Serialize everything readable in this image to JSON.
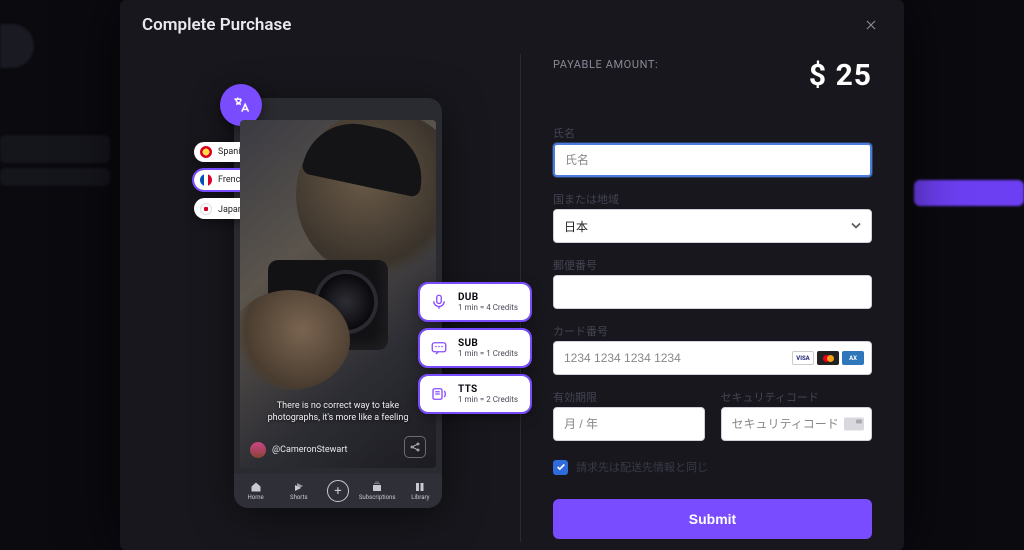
{
  "modal": {
    "title": "Complete Purchase",
    "close_icon": "close"
  },
  "payment": {
    "amount_label": "PAYABLE AMOUNT:",
    "amount_value": "$ 25"
  },
  "illustration": {
    "translate_icon": "translate",
    "languages": [
      {
        "label": "Spanish (Español)",
        "flag": "es",
        "selected": false
      },
      {
        "label": "French (français)",
        "flag": "fr",
        "selected": true
      },
      {
        "label": "Japanese (日本)",
        "flag": "jp",
        "selected": false
      }
    ],
    "caption": "There is no correct way to take photographs, it's more like a feeling",
    "username": "@CameronStewart",
    "nav": {
      "home": "Home",
      "shorts": "Shorts",
      "subscriptions": "Subscriptions",
      "library": "Library"
    },
    "credits": [
      {
        "title": "DUB",
        "sub": "1 min = 4 Credits",
        "icon": "mic"
      },
      {
        "title": "SUB",
        "sub": "1 min = 1 Credits",
        "icon": "chat"
      },
      {
        "title": "TTS",
        "sub": "1 min = 2 Credits",
        "icon": "speaker"
      }
    ]
  },
  "form": {
    "name": {
      "label": "氏名",
      "placeholder": "氏名",
      "value": ""
    },
    "country": {
      "label": "国または地域",
      "value": "日本"
    },
    "postal": {
      "label": "郵便番号",
      "placeholder": "",
      "value": ""
    },
    "card": {
      "label": "カード番号",
      "placeholder": "1234 1234 1234 1234",
      "value": ""
    },
    "expiry": {
      "label": "有効期限",
      "placeholder": "月 / 年",
      "value": ""
    },
    "cvc": {
      "label": "セキュリティコード",
      "placeholder": "セキュリティコード",
      "value": ""
    },
    "same_as_shipping": {
      "checked": true,
      "label": "請求先は配送先情報と同じ"
    },
    "submit_label": "Submit"
  },
  "colors": {
    "accent": "#7a4cff"
  }
}
